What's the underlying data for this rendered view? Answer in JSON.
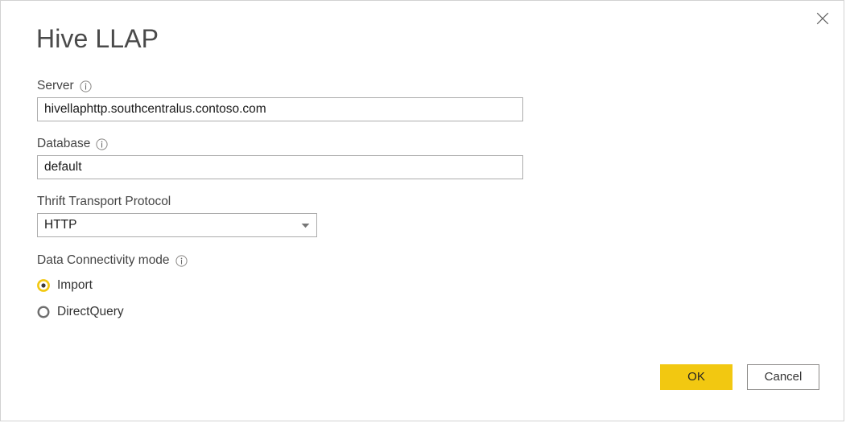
{
  "dialog": {
    "title": "Hive LLAP",
    "close_icon": "close-icon"
  },
  "form": {
    "server": {
      "label": "Server",
      "info_icon": "info-icon",
      "value": "hivellaphttp.southcentralus.contoso.com",
      "placeholder": ""
    },
    "database": {
      "label": "Database",
      "info_icon": "info-icon",
      "value": "default",
      "placeholder": ""
    },
    "thrift_transport_protocol": {
      "label": "Thrift Transport Protocol",
      "value": "HTTP",
      "caret_icon": "chevron-down-icon"
    }
  },
  "connectivity": {
    "label": "Data Connectivity mode",
    "info_icon": "info-icon",
    "selected": "Import",
    "options": [
      {
        "label": "Import",
        "selected": true
      },
      {
        "label": "DirectQuery",
        "selected": false
      }
    ]
  },
  "footer": {
    "ok_label": "OK",
    "cancel_label": "Cancel"
  },
  "colors": {
    "accent_yellow": "#f2c811",
    "radio_selected_ring": "#f2c811",
    "radio_selected_dot": "#3b3a39",
    "radio_unselected_ring": "#6e6e6e",
    "input_border": "#acacac",
    "dialog_border": "#d2d2d2",
    "label_text": "#444444",
    "title_text": "#4a4a4a"
  }
}
